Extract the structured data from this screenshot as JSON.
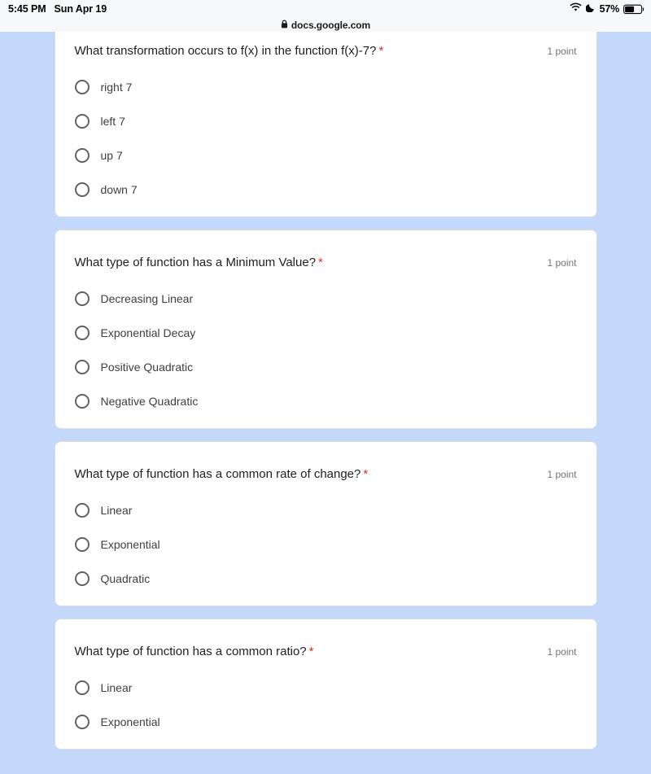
{
  "status_bar": {
    "time": "5:45 PM",
    "date": "Sun Apr 19",
    "wifi_icon": "wifi-icon",
    "dnd_icon": "crescent-moon-icon",
    "battery_percent": "57%",
    "battery_icon": "battery-icon"
  },
  "browser": {
    "lock_icon": "lock-icon",
    "url": "docs.google.com"
  },
  "colors": {
    "page_background": "#c3d8fa",
    "card_background": "#ffffff",
    "required_star": "#d93025",
    "question_text": "#202124",
    "option_text": "#3c4043",
    "points_text": "#70757a",
    "radio_border": "#5f6368"
  },
  "form": {
    "questions": [
      {
        "title": "What transformation occurs to f(x) in the function f(x)-7?",
        "required_marker": "*",
        "points": "1 point",
        "options": [
          {
            "label": "right 7"
          },
          {
            "label": "left 7"
          },
          {
            "label": "up 7"
          },
          {
            "label": "down 7"
          }
        ]
      },
      {
        "title": "What type of function has a Minimum Value?",
        "required_marker": "*",
        "points": "1 point",
        "options": [
          {
            "label": "Decreasing Linear"
          },
          {
            "label": "Exponential Decay"
          },
          {
            "label": "Positive Quadratic"
          },
          {
            "label": "Negative Quadratic"
          }
        ]
      },
      {
        "title": "What type of function has a common rate of change?",
        "required_marker": "*",
        "points": "1 point",
        "options": [
          {
            "label": "Linear"
          },
          {
            "label": "Exponential"
          },
          {
            "label": "Quadratic"
          }
        ]
      },
      {
        "title": "What type of function has a common ratio?",
        "required_marker": "*",
        "points": "1 point",
        "options": [
          {
            "label": "Linear"
          },
          {
            "label": "Exponential"
          }
        ]
      }
    ]
  }
}
